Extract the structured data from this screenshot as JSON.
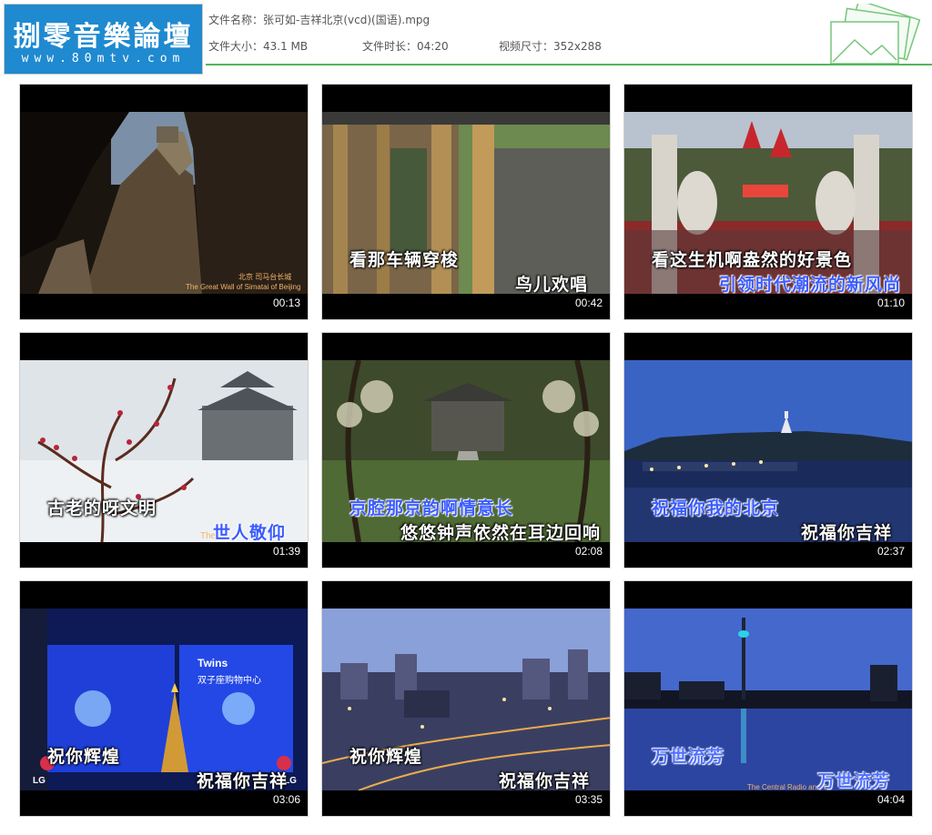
{
  "header": {
    "logo_title": "捌零音樂論壇",
    "logo_url": "www.80mtv.com",
    "file_name_label": "文件名称：",
    "file_name": "张可如-吉祥北京(vcd)(国语).mpg",
    "file_size_label": "文件大小：",
    "file_size": "43.1 MB",
    "duration_label": "文件时长：",
    "duration": "04:20",
    "resolution_label": "视频尺寸：",
    "resolution": "352x288"
  },
  "thumbnails": [
    {
      "time": "00:13",
      "subtitles": [],
      "captions": [
        "北京 司马台长城",
        "The Great Wall of Simatai of Beijing"
      ]
    },
    {
      "time": "00:42",
      "subtitles": [
        "看那车辆穿梭",
        "鸟儿欢唱"
      ],
      "captions": []
    },
    {
      "time": "01:10",
      "subtitles": [
        "看这生机啊盎然的好景色",
        "引领时代潮流的新风尚"
      ],
      "captions": []
    },
    {
      "time": "01:39",
      "subtitles": [
        "古老的呀文明",
        "世人敬仰"
      ],
      "captions": [
        "The"
      ]
    },
    {
      "time": "02:08",
      "subtitles": [
        "京腔那京韵啊情意长",
        "悠悠钟声依然在耳边回响"
      ],
      "captions": []
    },
    {
      "time": "02:37",
      "subtitles": [
        "祝福你我的北京",
        "祝福你吉祥"
      ],
      "captions": []
    },
    {
      "time": "03:06",
      "subtitles": [
        "祝你辉煌",
        "祝福你吉祥"
      ],
      "captions": [
        "Twins",
        "双子座购物中心",
        "LG",
        "LG"
      ]
    },
    {
      "time": "03:35",
      "subtitles": [
        "祝你辉煌",
        "祝福你吉祥"
      ],
      "captions": []
    },
    {
      "time": "04:04",
      "subtitles": [
        "万世流芳",
        "万世流芳"
      ],
      "captions": [
        "The Central Radio and T"
      ]
    }
  ]
}
